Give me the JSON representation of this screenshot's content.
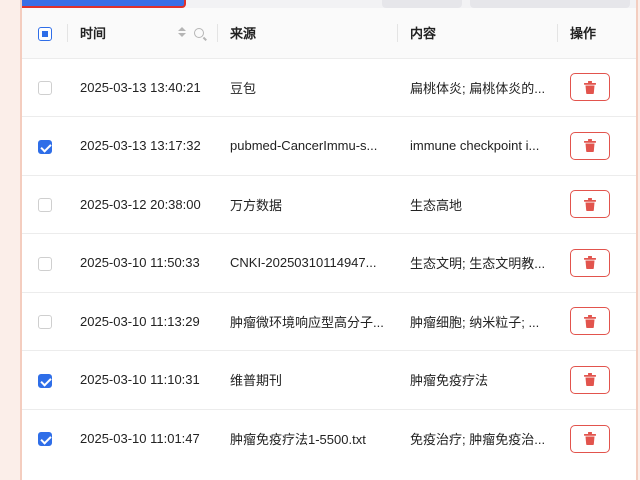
{
  "table": {
    "headers": {
      "time": "时间",
      "source": "来源",
      "content": "内容",
      "actions": "操作"
    },
    "rows": [
      {
        "checked": false,
        "time": "2025-03-13 13:40:21",
        "source": "豆包",
        "content": "扁桃体炎; 扁桃体炎的..."
      },
      {
        "checked": true,
        "time": "2025-03-13 13:17:32",
        "source": "pubmed-CancerImmu-s...",
        "content": "immune checkpoint i..."
      },
      {
        "checked": false,
        "time": "2025-03-12 20:38:00",
        "source": "万方数据",
        "content": "生态高地"
      },
      {
        "checked": false,
        "time": "2025-03-10 11:50:33",
        "source": "CNKI-20250310114947...",
        "content": "生态文明; 生态文明教..."
      },
      {
        "checked": false,
        "time": "2025-03-10 11:13:29",
        "source": "肿瘤微环境响应型高分子...",
        "content": "肿瘤细胞; 纳米粒子; ..."
      },
      {
        "checked": true,
        "time": "2025-03-10 11:10:31",
        "source": "维普期刊",
        "content": "肿瘤免疫疗法"
      },
      {
        "checked": true,
        "time": "2025-03-10 11:01:47",
        "source": "肿瘤免疫疗法1-5500.txt",
        "content": "免疫治疗; 肿瘤免疫治..."
      }
    ]
  },
  "colors": {
    "accent": "#2f6ee8",
    "danger": "#e2544d"
  },
  "icons": {
    "header": [
      "sort-icon",
      "search-icon"
    ],
    "row_action": "trash-icon"
  }
}
